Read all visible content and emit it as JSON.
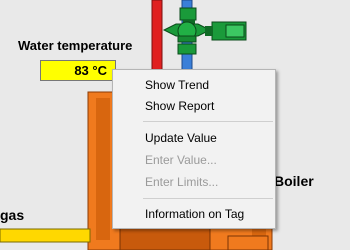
{
  "scene": {
    "water_temperature_label": "Water temperature",
    "water_temperature_value": "83 °C",
    "boiler_label": "Boiler",
    "gas_label": "gas"
  },
  "context_menu": {
    "items": [
      {
        "label": "Show Trend",
        "enabled": true
      },
      {
        "label": "Show Report",
        "enabled": true
      },
      {
        "label": "Update Value",
        "enabled": true
      },
      {
        "label": "Enter Value...",
        "enabled": false
      },
      {
        "label": "Enter Limits...",
        "enabled": false
      },
      {
        "label": "Information on Tag",
        "enabled": true
      }
    ]
  },
  "colors": {
    "boiler": "#f07a1e",
    "pipe_red": "#e02020",
    "pipe_blue": "#3a7fd8",
    "valve_green": "#1a9a3a",
    "gas_pipe": "#ffd800",
    "temp_box": "#ffff00"
  }
}
